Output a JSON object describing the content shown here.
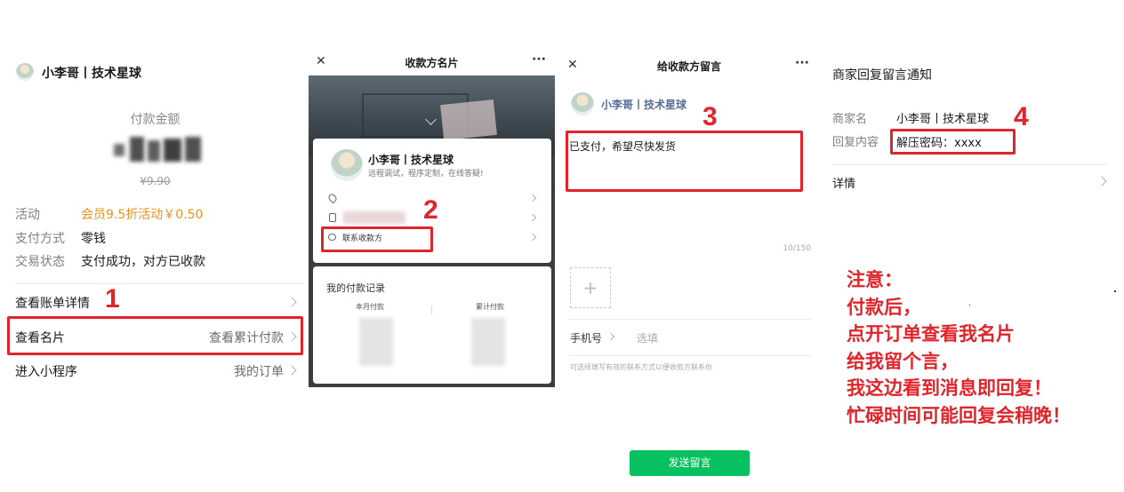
{
  "panel1": {
    "merchant_name": "小李哥丨技术星球",
    "amount_label": "付款金额",
    "original_price": "¥9.90",
    "fields": [
      {
        "label": "活动",
        "value": "会员9.5折活动￥0.50",
        "color": "#e8931f"
      },
      {
        "label": "支付方式",
        "value": "零钱",
        "color": "#191919"
      },
      {
        "label": "交易状态",
        "value": "支付成功，对方已收款",
        "color": "#191919"
      }
    ],
    "rows": [
      {
        "label": "查看账单详情",
        "value": ""
      },
      {
        "label": "查看名片",
        "value": "查看累计付款"
      },
      {
        "label": "进入小程序",
        "value": "我的订单"
      }
    ],
    "step_number": "1"
  },
  "panel2": {
    "close_glyph": "✕",
    "title": "收款方名片",
    "more_glyph": "···",
    "card_name": "小李哥丨技术星球",
    "card_desc": "远程调试，程序定制，在线答疑!",
    "contact_label": "联系收款方",
    "records_title": "我的付款记录",
    "month_label": "本月付款",
    "total_label": "累计付款",
    "step_number": "2"
  },
  "panel3": {
    "close_glyph": "✕",
    "title": "给收款方留言",
    "more_glyph": "···",
    "name": "小李哥丨技术星球",
    "message": "已支付，希望尽快发货",
    "counter": "10/150",
    "add_glyph": "+",
    "phone_label": "手机号",
    "phone_placeholder": "选填",
    "hint": "可选择填写有效的联系方式以便收款方联系你",
    "send_label": "发送留言",
    "step_number": "3"
  },
  "panel4": {
    "title": "商家回复留言通知",
    "merchant_label": "商家名",
    "merchant_value": "小李哥丨技术星球",
    "reply_label": "回复内容",
    "reply_value": "解压密码：xxxx",
    "details_label": "详情",
    "step_number": "4"
  },
  "note": {
    "lines": [
      "注意：",
      "付款后，",
      "点开订单查看我名片",
      "给我留个言，",
      "我这边看到消息即回复！",
      "忙碌时间可能回复会稍晚！"
    ]
  },
  "colors": {
    "accent_red": "#e0242b",
    "wechat_green": "#07c160",
    "activity_orange": "#e8931f",
    "link_blue": "#576b95"
  },
  "icons": [
    "location-icon",
    "phone-icon",
    "chat-icon",
    "chevron-right-icon",
    "close-icon",
    "more-icon",
    "chevron-down-icon",
    "add-icon"
  ]
}
